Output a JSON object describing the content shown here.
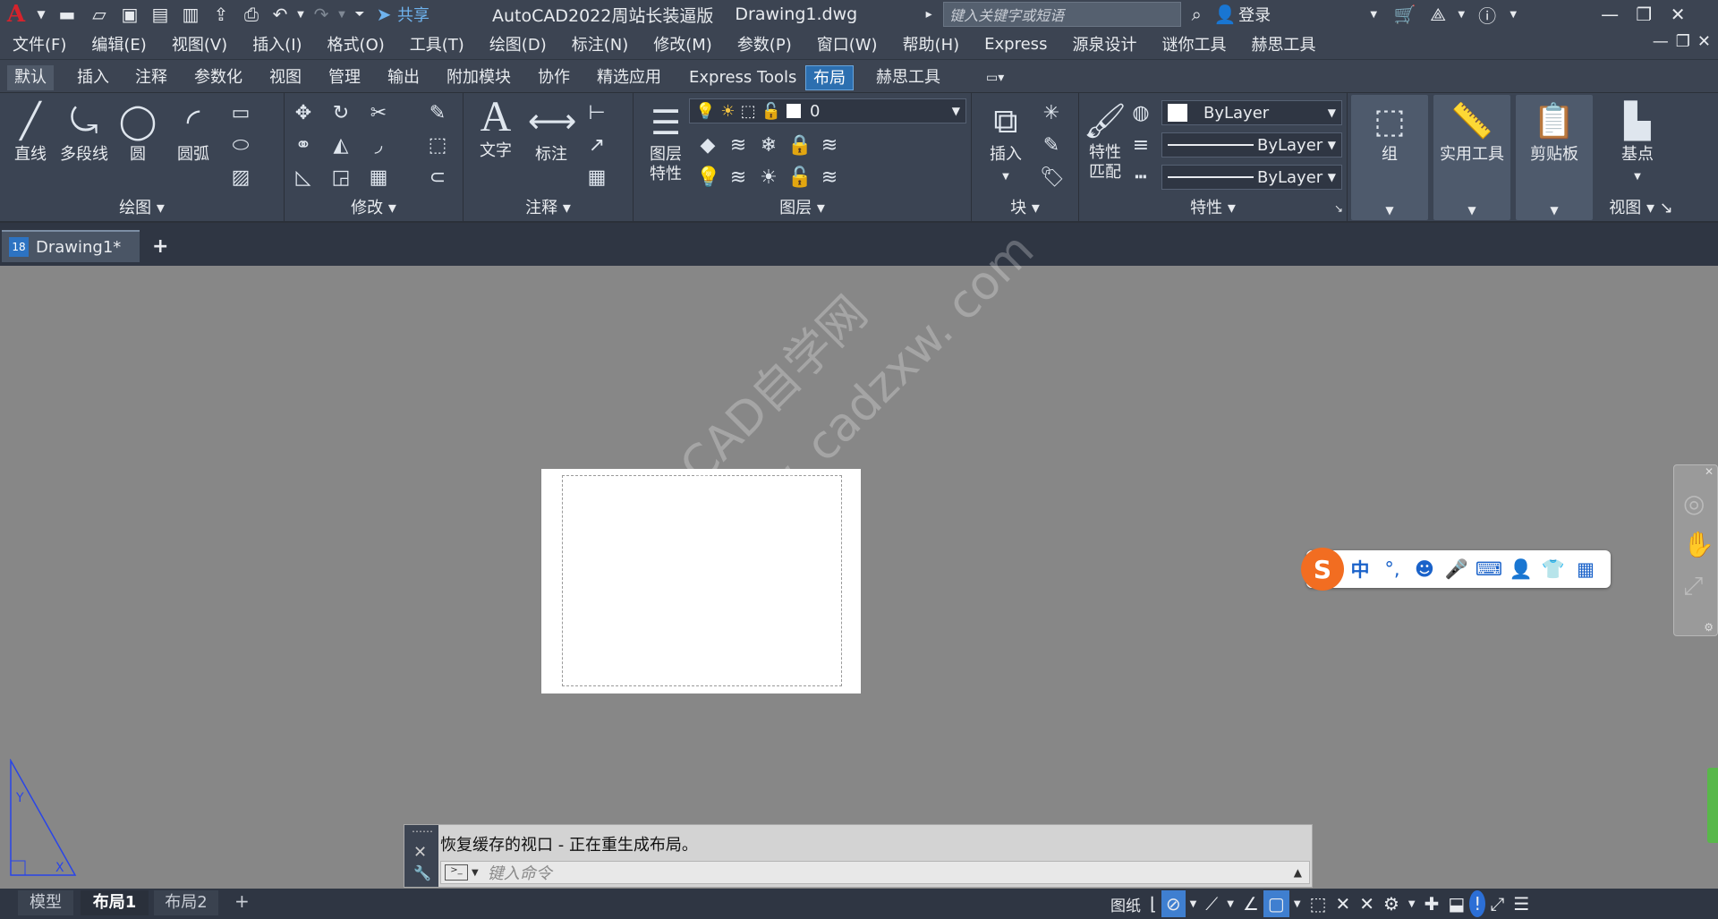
{
  "titlebar": {
    "app_logo": "A",
    "share_label": "共享",
    "title": "AutoCAD2022周站长装逼版",
    "filename": "Drawing1.dwg",
    "search_placeholder": "键入关键字或短语",
    "login_label": "登录"
  },
  "menubar": {
    "items": [
      "文件(F)",
      "编辑(E)",
      "视图(V)",
      "插入(I)",
      "格式(O)",
      "工具(T)",
      "绘图(D)",
      "标注(N)",
      "修改(M)",
      "参数(P)",
      "窗口(W)",
      "帮助(H)",
      "Express",
      "源泉设计",
      "谜你工具",
      "赫思工具"
    ]
  },
  "ribbon_tabs": {
    "items": [
      "默认",
      "插入",
      "注释",
      "参数化",
      "视图",
      "管理",
      "输出",
      "附加模块",
      "协作",
      "精选应用",
      "Express Tools",
      "布局",
      "赫思工具"
    ],
    "active": "布局"
  },
  "ribbon": {
    "draw": {
      "title": "绘图",
      "line": "直线",
      "polyline": "多段线",
      "circle": "圆",
      "arc": "圆弧"
    },
    "modify": {
      "title": "修改"
    },
    "annotation": {
      "title": "注释",
      "text": "文字",
      "dimension": "标注"
    },
    "layers": {
      "title": "图层",
      "layer_props_1": "图层",
      "layer_props_2": "特性",
      "current_layer": "0"
    },
    "block": {
      "title": "块",
      "insert": "插入"
    },
    "properties": {
      "title": "特性",
      "match_1": "特性",
      "match_2": "匹配",
      "color": "ByLayer",
      "linetype": "ByLayer",
      "lineweight": "ByLayer"
    },
    "group": {
      "label": "组"
    },
    "utilities": {
      "label": "实用工具"
    },
    "clipboard": {
      "label": "剪贴板"
    },
    "view": {
      "title": "视图",
      "base": "基点"
    }
  },
  "doc_tabs": {
    "active": "Drawing1*"
  },
  "command": {
    "history": "恢复缓存的视口  -  正在重生成布局。",
    "placeholder": "键入命令"
  },
  "layout_tabs": {
    "items": [
      "模型",
      "布局1",
      "布局2"
    ],
    "active": "布局1"
  },
  "status": {
    "paper_label": "图纸"
  },
  "watermark": {
    "line1": "CAD自学网",
    "line2": "www. cadzxw. com"
  },
  "ime": {
    "lang": "中",
    "punct": "°,"
  },
  "colors": {
    "ribbon_bg": "#3b4453",
    "active_tab": "#2c6fb0",
    "canvas": "#878787"
  }
}
